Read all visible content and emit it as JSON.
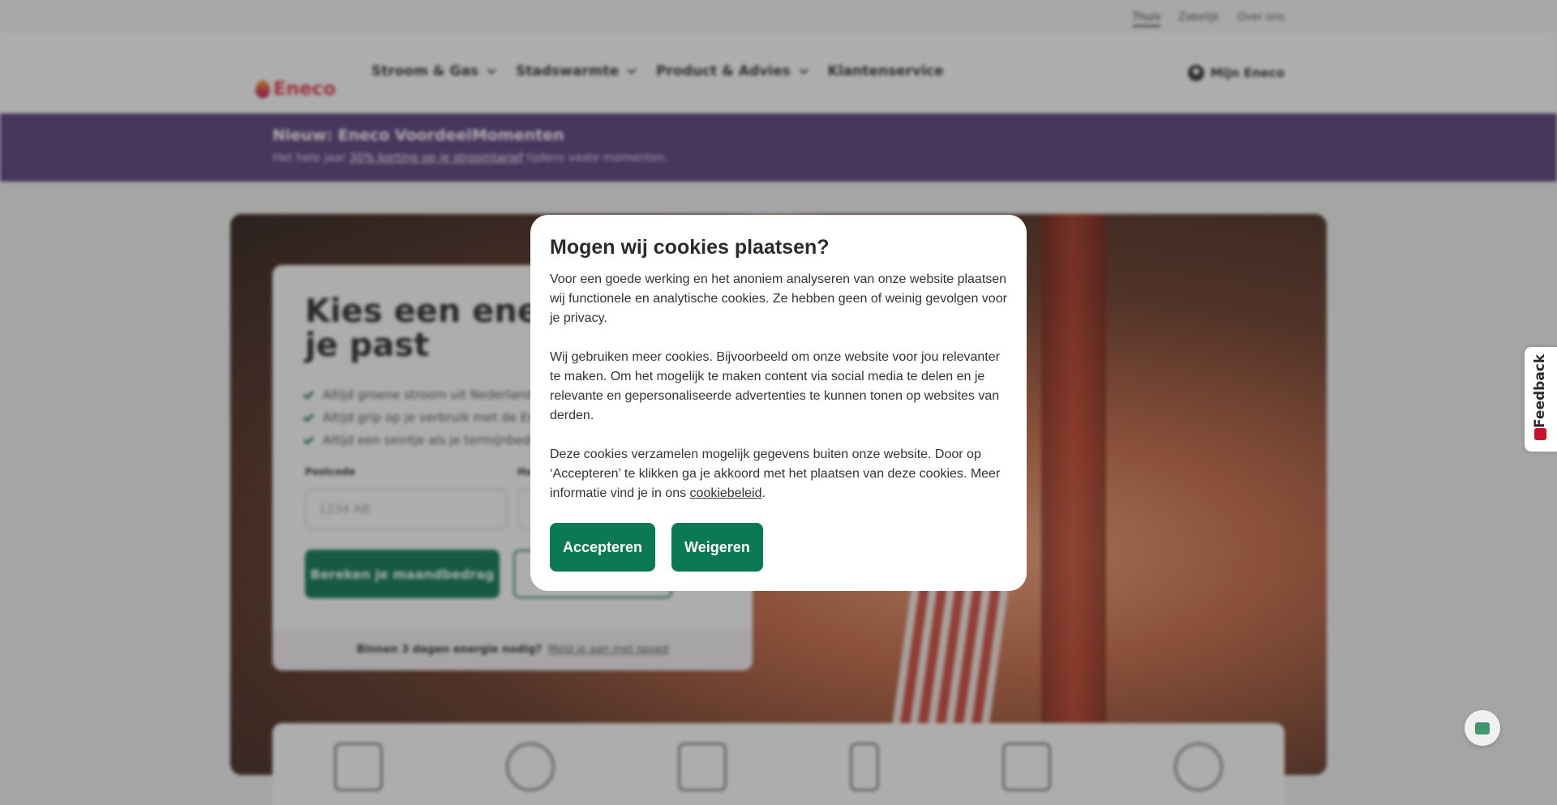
{
  "topbar": {
    "links": [
      "Thuis",
      "Zakelijk",
      "Over ons"
    ],
    "active": "Thuis"
  },
  "nav": {
    "logo_text": "Eneco",
    "menu": [
      {
        "label": "Stroom & Gas",
        "dropdown": true
      },
      {
        "label": "Stadswarmte",
        "dropdown": true
      },
      {
        "label": "Product & Advies",
        "dropdown": true
      },
      {
        "label": "Klantenservice",
        "dropdown": false
      }
    ],
    "account_label": "Mijn Eneco"
  },
  "promo": {
    "title": "Nieuw: Eneco VoordeelMomenten",
    "text_before": "Het hele jaar",
    "link": "30% korting op je stroomtarief",
    "text_after": "tijdens vaste momenten."
  },
  "hero_card": {
    "title": "Kies een energ dat bij je past",
    "usps": [
      "Altijd groene stroom uit Nederland",
      "Altijd grip op je verbruik met de Er",
      "Altijd een seintje als je termijnbedra"
    ],
    "postcode_label": "Postcode",
    "postcode_placeholder": "1234 AB",
    "house_label": "Hu",
    "calc_button": "Bereken je maandbedrag",
    "footer_bold": "Binnen 3 dagen energie nodig?",
    "footer_link": "Meld je aan met spoed"
  },
  "feedback": {
    "label": "Feedback"
  },
  "cookie_modal": {
    "title": "Mogen wij cookies plaatsen?",
    "paragraph1": "Voor een goede werking en het anoniem analyseren van onze website plaatsen wij functionele en analytische cookies. Ze hebben geen of weinig gevolgen voor je privacy.",
    "paragraph2": "Wij gebruiken meer cookies. Bijvoorbeeld om onze website voor jou relevanter te maken. Om het mogelijk te maken content via social media te delen en je relevante en gepersonaliseerde advertenties te kunnen tonen op websites van derden.",
    "paragraph3_before": "Deze cookies verzamelen mogelijk gegevens buiten onze website. Door op ‘Accepteren’ te klikken ga je akkoord met het plaatsen van deze cookies. Meer informatie vind je in ons",
    "paragraph3_link": "cookiebeleid",
    "paragraph3_after": ".",
    "accept_label": "Accepteren",
    "reject_label": "Weigeren"
  },
  "colors": {
    "brand_green": "#0b7a52",
    "promo_purple": "#5c3f7f",
    "brand_red": "#e5384c"
  }
}
